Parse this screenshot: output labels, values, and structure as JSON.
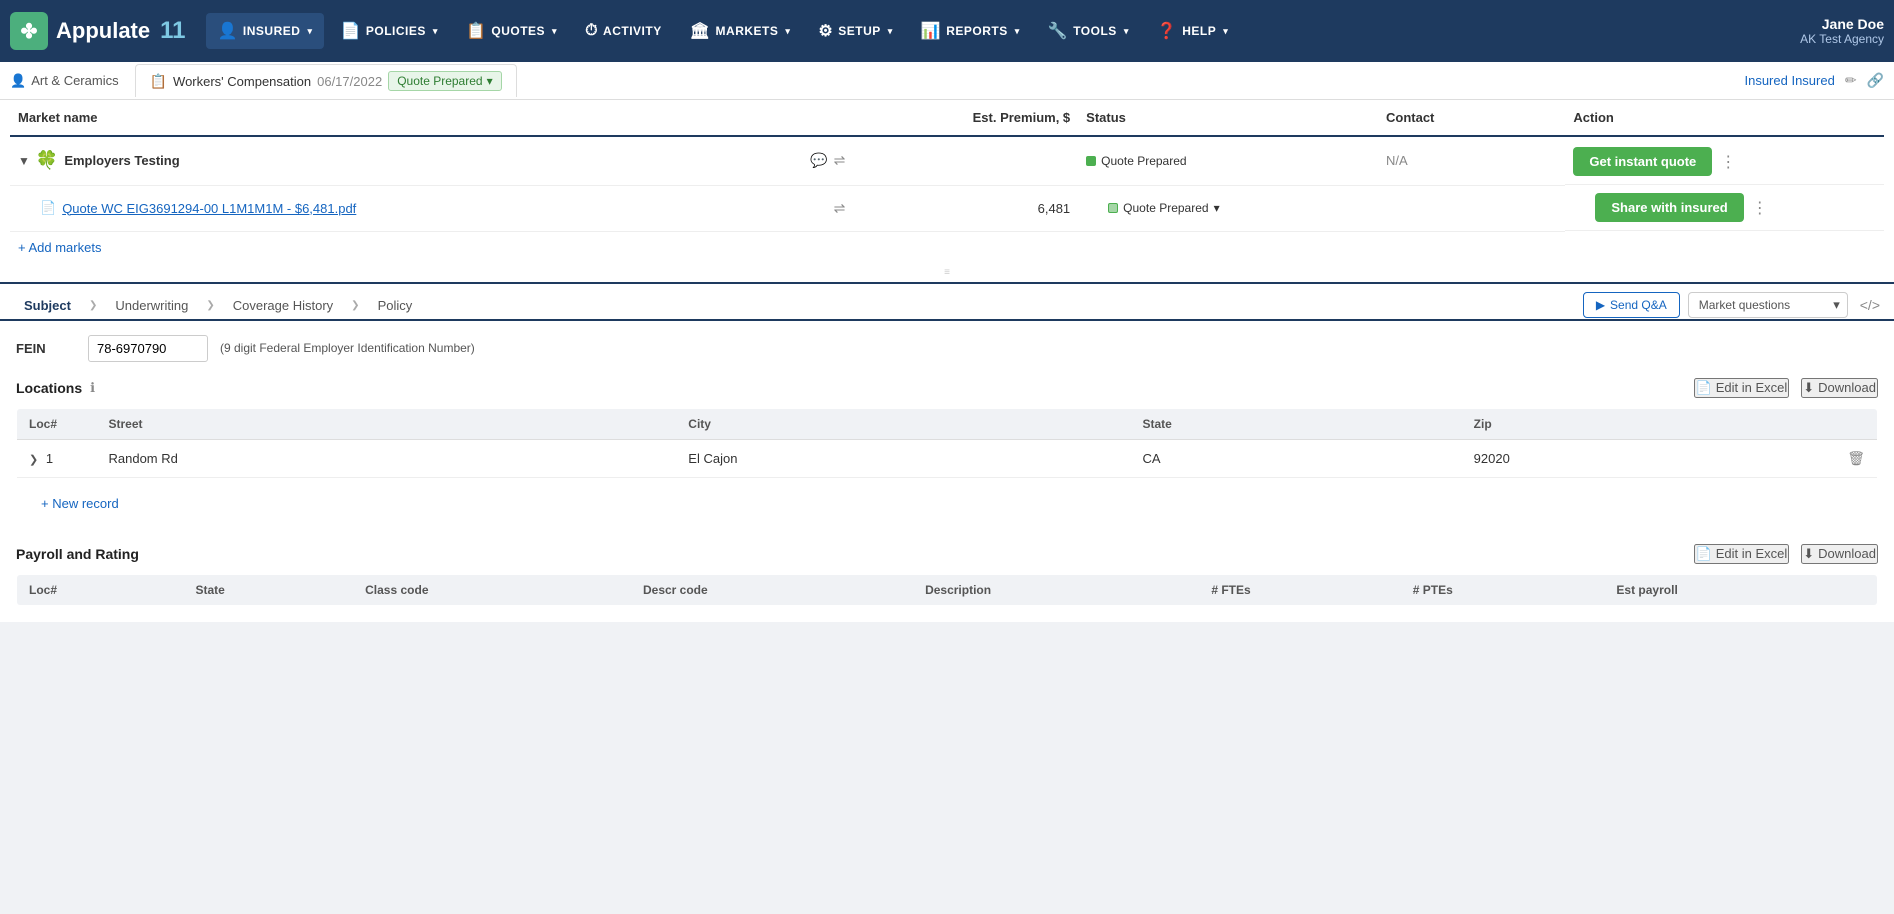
{
  "app": {
    "logo_symbol": "✤",
    "logo_name": "Appulate",
    "logo_number": "11"
  },
  "nav": {
    "items": [
      {
        "id": "insured",
        "label": "INSURED",
        "icon": "👤",
        "active": true,
        "has_dropdown": true
      },
      {
        "id": "policies",
        "label": "POLICIES",
        "icon": "📄",
        "active": false,
        "has_dropdown": true
      },
      {
        "id": "quotes",
        "label": "QUOTES",
        "icon": "📋",
        "active": false,
        "has_dropdown": true
      },
      {
        "id": "activity",
        "label": "ACTIVITY",
        "icon": "⏱",
        "active": false,
        "has_dropdown": false
      },
      {
        "id": "markets",
        "label": "MARKETS",
        "icon": "🏛",
        "active": false,
        "has_dropdown": true
      },
      {
        "id": "setup",
        "label": "SETUP",
        "icon": "⚙",
        "active": false,
        "has_dropdown": true
      },
      {
        "id": "reports",
        "label": "REPORTS",
        "icon": "📊",
        "active": false,
        "has_dropdown": true
      },
      {
        "id": "tools",
        "label": "TOOLS",
        "icon": "🔧",
        "active": false,
        "has_dropdown": true
      },
      {
        "id": "help",
        "label": "HELP",
        "icon": "❓",
        "active": false,
        "has_dropdown": true
      }
    ]
  },
  "user": {
    "name": "Jane Doe",
    "agency": "AK Test Agency"
  },
  "breadcrumb": {
    "insured_icon": "👤",
    "insured_label": "Art & Ceramics",
    "tab_icon": "📋",
    "tab_policy": "Workers' Compensation",
    "tab_date": "06/17/2022",
    "tab_status": "Quote Prepared",
    "insured_link": "Insured Insured",
    "edit_icon": "✏",
    "share_icon": "🔗"
  },
  "market_table": {
    "columns": [
      "Market name",
      "Est. Premium, $",
      "Status",
      "Contact",
      "Action"
    ],
    "rows": [
      {
        "type": "market",
        "expanded": true,
        "name": "Employers Testing",
        "premium": "",
        "status": "Quote Prepared",
        "status_type": "green",
        "contact": "N/A",
        "action": "Get instant quote",
        "more": true
      }
    ],
    "quote_row": {
      "indent": true,
      "file_icon": "📄",
      "quote_link": "Quote WC EIG3691294-00 L1M1M1M - $6,481.pdf",
      "premium": "6,481",
      "status": "Quote Prepared",
      "status_type": "light_green",
      "action": "Share with insured",
      "more": true
    },
    "add_markets_label": "+ Add markets"
  },
  "tabs": {
    "items": [
      {
        "id": "subject",
        "label": "Subject",
        "active": true
      },
      {
        "id": "underwriting",
        "label": "Underwriting",
        "active": false
      },
      {
        "id": "coverage_history",
        "label": "Coverage History",
        "active": false
      },
      {
        "id": "policy",
        "label": "Policy",
        "active": false
      }
    ],
    "send_qa_label": "Send Q&A",
    "send_qa_icon": "▶",
    "market_questions_placeholder": "Market questions",
    "code_btn": "</>",
    "dropdown_arrow": "▾"
  },
  "form": {
    "fein_label": "FEIN",
    "fein_value": "78-6970790",
    "fein_hint": "(9 digit Federal Employer Identification Number)"
  },
  "locations": {
    "title": "Locations",
    "help_icon": "?",
    "edit_excel_label": "Edit in Excel",
    "download_label": "Download",
    "columns": [
      "Loc#",
      "Street",
      "City",
      "State",
      "Zip"
    ],
    "rows": [
      {
        "loc_num": "1",
        "street": "Random Rd",
        "city": "El Cajon",
        "state": "CA",
        "zip": "92020"
      }
    ],
    "new_record_label": "+ New record"
  },
  "payroll": {
    "title": "Payroll and Rating",
    "edit_excel_label": "Edit in Excel",
    "download_label": "Download",
    "columns": [
      "Loc#",
      "State",
      "Class code",
      "Descr code",
      "Description",
      "# FTEs",
      "# PTEs",
      "Est payroll"
    ]
  },
  "colors": {
    "nav_bg": "#1e3a5f",
    "green_btn": "#4caf50",
    "blue_link": "#1565c0",
    "header_border": "#1e3a5f"
  }
}
